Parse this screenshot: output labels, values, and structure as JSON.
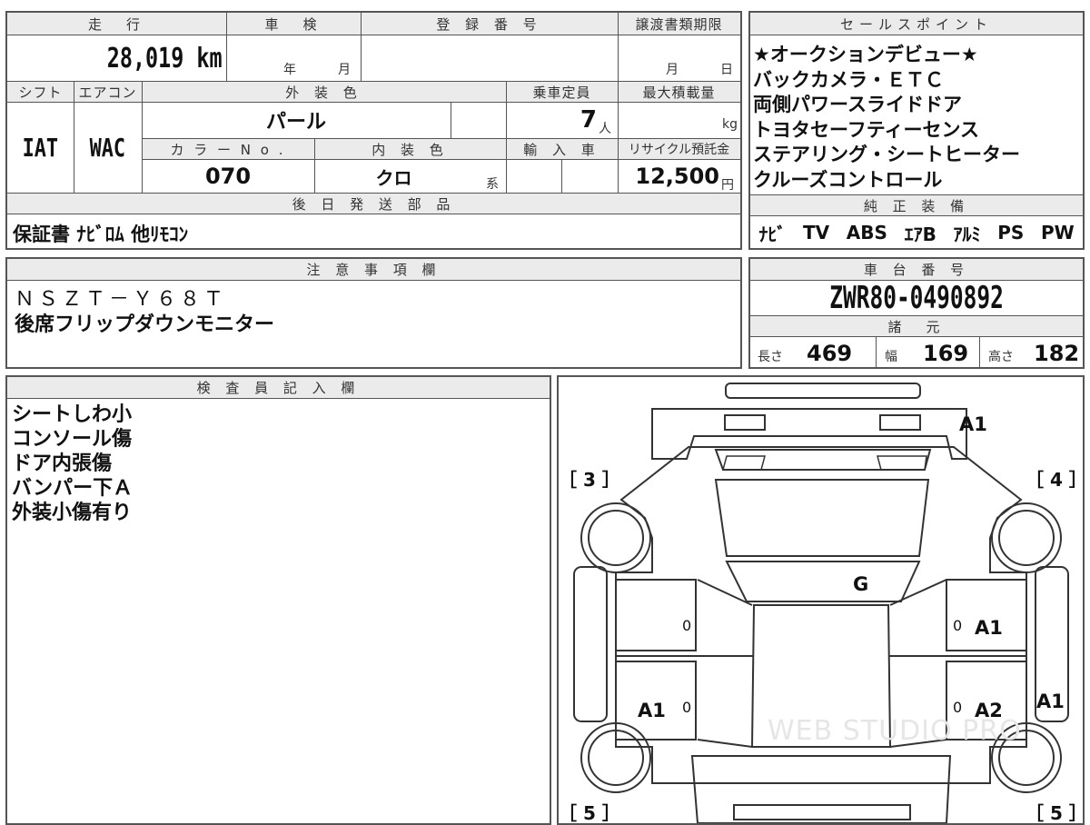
{
  "top": {
    "mileage_header": "走　行",
    "mileage": "28,019 km",
    "shaken_header": "車　検",
    "shaken_year": "年",
    "shaken_month": "月",
    "reg_header": "登 録 番 号",
    "deadline_header": "譲渡書類期限",
    "deadline_month": "月",
    "deadline_day": "日",
    "shift_header": "シフト",
    "aircon_header": "エアコン",
    "exterior_header": "外 装 色",
    "capacity_header": "乗車定員",
    "maxload_header": "最大積載量",
    "shift": "IAT",
    "aircon": "WAC",
    "exterior": "パール",
    "capacity": "7",
    "capacity_unit": "人",
    "maxload_unit": "kg",
    "colorno_header": "カ ラ ー N o .",
    "interior_header": "内 装 色",
    "import_header": "輸 入 車",
    "recycle_header": "リサイクル預託金",
    "colorno": "070",
    "interior": "クロ",
    "interior_unit": "系",
    "recycle": "12,500",
    "recycle_unit": "円",
    "later_header": "後 日 発 送 部 品",
    "later_items": "保証書 ﾅﾋﾞﾛﾑ 他ﾘﾓｺﾝ"
  },
  "sales": {
    "header": "セールスポイント",
    "lines": [
      "★オークションデビュー★",
      "バックカメラ・ＥＴＣ",
      "両側パワースライドドア",
      "トヨタセーフティーセンス",
      "ステアリング・シートヒーター",
      "クルーズコントロール"
    ],
    "equip_header": "純 正 装 備",
    "equip": [
      "ﾅﾋﾞ",
      "TV",
      "ABS",
      "ｴｱB",
      "ｱﾙﾐ",
      "PS",
      "PW"
    ]
  },
  "notes": {
    "header": "注 意 事 項 欄",
    "lines": [
      "ＮＳＺＴ－Ｙ６８Ｔ",
      "後席フリップダウンモニター"
    ]
  },
  "chassis": {
    "header": "車 台 番 号",
    "number": "ZWR80-0490892",
    "spec_header": "諸　元",
    "length_label": "長さ",
    "length": "469",
    "width_label": "幅",
    "width": "169",
    "height_label": "高さ",
    "height": "182"
  },
  "inspector": {
    "header": "検 査 員 記 入 欄",
    "lines": [
      "シートしわ小",
      "コンソール傷",
      "ドア内張傷",
      "バンパー下Ａ",
      "外装小傷有り"
    ]
  },
  "diagram": {
    "label_3": "［ 3 ］",
    "label_4": "［ 4 ］",
    "label_5l": "［ 5 ］",
    "label_5r": "［ 5 ］",
    "rear_mark": "A1",
    "roof_mark": "G",
    "right_front_mark": "A1",
    "left_rear_mark": "A1",
    "right_rear_mark": "A2",
    "right_side_mark": "A1",
    "zero": "0",
    "watermark": "WEB STUDIO PRO"
  }
}
